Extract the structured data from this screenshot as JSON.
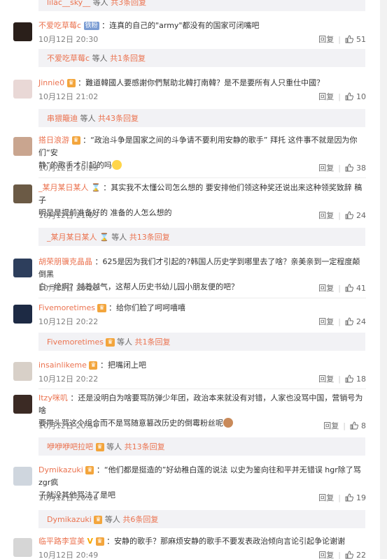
{
  "top_reply": {
    "user": "lilac__sky__",
    "text_mid": "等人",
    "text_count": "共3条回复"
  },
  "actions": {
    "reply": "回复"
  },
  "comments": [
    {
      "user": "不爱吃草莓c",
      "badge": "铁粉",
      "text": "：连真的自己的\"army\"都没有的国家可闭嘴吧",
      "text2": "",
      "time": "10月12日 20:30",
      "likes": "51"
    },
    {
      "user": "Jinnie0",
      "badge": "",
      "text": "：難道韓國人要感謝你們幫助北韓打南韓？是不是要所有人只重仕中國？",
      "text2": "",
      "time": "10月12日 21:02",
      "likes": "10"
    },
    {
      "user": "搭日浪游",
      "badge": "",
      "text": "：“政治斗争是国家之间的斗争请不要利用安静的歌手” 拜托 这件事不就是因为你们“安",
      "text2": "静”的歌手才引起的吗",
      "time": "10月12日 20:23",
      "likes": "38"
    },
    {
      "user": "_某月某日某人",
      "badge": "",
      "text": "：其实我不太懂公司怎么想的 要安排他们领这种奖还说出来这种领奖致辞 稿子",
      "text2": "明显是提前准备好的 准备的人怎么想的",
      "time": "10月12日 21:05",
      "likes": "24"
    },
    {
      "user": "胡荣朋骥克晶晶",
      "badge": "",
      "text": "：625是因为我们才引起的?韩国人历史学到哪里去了啥？亲美亲到一定程度颠倒黑",
      "text2": "白一绝啊？越着越气，这帮人历史书幼儿园小朋友便的吧？",
      "time": "10月12日 20:23",
      "likes": "41"
    },
    {
      "user": "Fivemoretimes",
      "badge": "",
      "text": "：给你们脸了呵呵嘻嘻",
      "text2": "",
      "time": "10月12日 20:22",
      "likes": "24"
    },
    {
      "user": "insainlikeme",
      "badge": "",
      "text": "：把嘴闭上吧",
      "text2": "",
      "time": "10月12日 20:22",
      "likes": "18"
    },
    {
      "user": "Itzy咪叽",
      "badge": "",
      "text": "：还是没明白为啥要骂防弹少年团，政治本来就没有对错，人家也没骂中国，营销号为啥",
      "text2": "要带头骂这个组合而不是骂随意篡改历史的倒霉粉丝呢",
      "time": "10月12日 20:54",
      "likes": "8"
    },
    {
      "user": "Dymikazuki",
      "badge": "",
      "text": "：“他们都是挺造的”好幼稚白莲的说法 以史为鉴向往和平并无错误 hgr除了骂zgr疯",
      "text2": "子就没其他骂法了是吧",
      "time": "10月12日 20:26",
      "likes": "19"
    },
    {
      "user": "临平路李宣美",
      "badge": "",
      "text": "：安静的歌手？那麻烦安静的歌手不要发表政治倾向言论引起争论谢谢",
      "text2": "",
      "time": "10月12日 20:49",
      "likes": "22"
    }
  ],
  "reply_summaries": [
    {
      "user": "不爱吃草莓c",
      "mid": "等人",
      "count": "共1条回复"
    },
    {
      "user": "串猥簸迪",
      "mid": "等人",
      "count": "共43条回复"
    },
    {
      "user": "_某月某日某人",
      "mid": "等人",
      "count": "共13条回复"
    },
    {
      "user": "Fivemoretimes",
      "mid": "等人",
      "count": "共1条回复"
    },
    {
      "user": "咿咿咿吧拉吧",
      "mid": "等人",
      "count": "共13条回复"
    },
    {
      "user": "Dymikazuki",
      "mid": "等人",
      "count": "共6条回复"
    }
  ]
}
